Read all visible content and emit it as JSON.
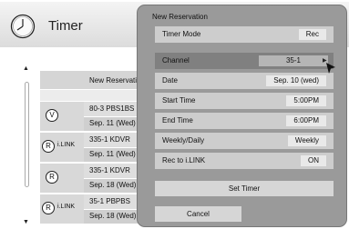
{
  "screen": {
    "title": "Timer",
    "list_header": "New Reservation",
    "rows": [
      {
        "badge": "V",
        "badge_label": "",
        "line1": "80-3  PBS1BS",
        "line2": "Sep. 11 (Wed)"
      },
      {
        "badge": "R",
        "badge_label": "i.LINK",
        "line1": "335-1  KDVR",
        "line2": "Sep. 11 (Wed)"
      },
      {
        "badge": "R",
        "badge_label": "",
        "line1": "335-1  KDVR",
        "line2": "Sep. 18 (Wed)"
      },
      {
        "badge": "R",
        "badge_label": "i.LINK",
        "line1": "35-1  PBPBS",
        "line2": "Sep. 18 (Wed)"
      }
    ]
  },
  "dialog": {
    "title": "New Reservation",
    "fields": [
      {
        "label": "Timer Mode",
        "value": "Rec"
      },
      {
        "label": "Channel",
        "value": "35-1"
      },
      {
        "label": "Date",
        "value": "Sep. 10 (wed)"
      },
      {
        "label": "Start Time",
        "value": "5:00PM"
      },
      {
        "label": "End Time",
        "value": "6:00PM"
      },
      {
        "label": "Weekly/Daily",
        "value": "Weekly"
      },
      {
        "label": "Rec to i.LINK",
        "value": "ON"
      }
    ],
    "set_timer_label": "Set Timer",
    "cancel_label": "Cancel"
  }
}
